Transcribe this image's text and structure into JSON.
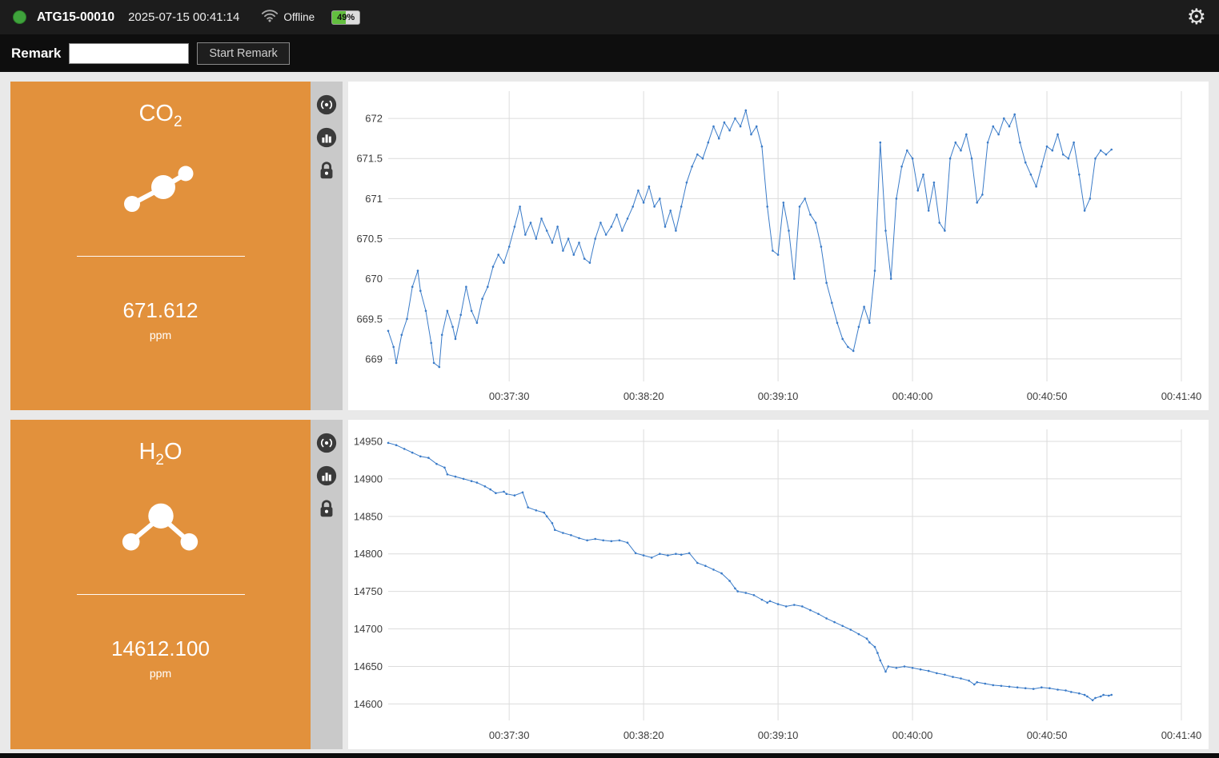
{
  "topbar": {
    "device_id": "ATG15-00010",
    "timestamp": "2025-07-15 00:41:14",
    "connection_status": "Offline",
    "battery_percent_label": "49%",
    "battery_level": 49,
    "status_dot_color": "#3fa33c",
    "accent_orange": "#e2913c",
    "chart_line_color": "#3a7bc8"
  },
  "remark": {
    "label": "Remark",
    "input_value": "",
    "button_label": "Start Remark"
  },
  "icons": {
    "gear": "⚙",
    "wifi": "wifi-arcs-offline",
    "battery": "battery-gauge",
    "status": "green-dot",
    "strip": [
      "broadcast",
      "bar-chart",
      "lock"
    ]
  },
  "panels": [
    {
      "gas": "co2",
      "formula": {
        "prefix": "CO",
        "sub": "2",
        "suffix": ""
      },
      "value": "671.612",
      "unit": "ppm"
    },
    {
      "gas": "h2o",
      "formula": {
        "prefix": "H",
        "sub": "2",
        "suffix": "O"
      },
      "value": "14612.100",
      "unit": "ppm"
    }
  ],
  "chart_data": [
    {
      "type": "line",
      "name": "co2",
      "series_name": "CO2 (ppm)",
      "color": "#3a7bc8",
      "grid": true,
      "x_domain_seconds": [
        0,
        295
      ],
      "x_ticks": [
        {
          "t": 45,
          "label": "00:37:30"
        },
        {
          "t": 95,
          "label": "00:38:20"
        },
        {
          "t": 145,
          "label": "00:39:10"
        },
        {
          "t": 195,
          "label": "00:40:00"
        },
        {
          "t": 245,
          "label": "00:40:50"
        },
        {
          "t": 295,
          "label": "00:41:40"
        }
      ],
      "ylim": [
        668.72,
        672.34
      ],
      "y_ticks": [
        {
          "v": 669,
          "label": "669"
        },
        {
          "v": 669.5,
          "label": "669.5"
        },
        {
          "v": 670,
          "label": "670"
        },
        {
          "v": 670.5,
          "label": "670.5"
        },
        {
          "v": 671,
          "label": "671"
        },
        {
          "v": 671.5,
          "label": "671.5"
        },
        {
          "v": 672,
          "label": "672"
        }
      ],
      "points": [
        [
          0,
          669.35
        ],
        [
          2,
          669.15
        ],
        [
          3,
          668.95
        ],
        [
          5,
          669.3
        ],
        [
          7,
          669.5
        ],
        [
          9,
          669.9
        ],
        [
          11,
          670.1
        ],
        [
          12,
          669.85
        ],
        [
          14,
          669.6
        ],
        [
          16,
          669.2
        ],
        [
          17,
          668.95
        ],
        [
          19,
          668.9
        ],
        [
          20,
          669.3
        ],
        [
          22,
          669.6
        ],
        [
          24,
          669.4
        ],
        [
          25,
          669.25
        ],
        [
          27,
          669.55
        ],
        [
          29,
          669.9
        ],
        [
          31,
          669.6
        ],
        [
          33,
          669.45
        ],
        [
          35,
          669.75
        ],
        [
          37,
          669.9
        ],
        [
          39,
          670.15
        ],
        [
          41,
          670.3
        ],
        [
          43,
          670.2
        ],
        [
          45,
          670.4
        ],
        [
          47,
          670.65
        ],
        [
          49,
          670.9
        ],
        [
          51,
          670.55
        ],
        [
          53,
          670.7
        ],
        [
          55,
          670.5
        ],
        [
          57,
          670.75
        ],
        [
          59,
          670.6
        ],
        [
          61,
          670.45
        ],
        [
          63,
          670.65
        ],
        [
          65,
          670.35
        ],
        [
          67,
          670.5
        ],
        [
          69,
          670.3
        ],
        [
          71,
          670.45
        ],
        [
          73,
          670.25
        ],
        [
          75,
          670.2
        ],
        [
          77,
          670.5
        ],
        [
          79,
          670.7
        ],
        [
          81,
          670.55
        ],
        [
          83,
          670.65
        ],
        [
          85,
          670.8
        ],
        [
          87,
          670.6
        ],
        [
          89,
          670.75
        ],
        [
          91,
          670.9
        ],
        [
          93,
          671.1
        ],
        [
          95,
          670.95
        ],
        [
          97,
          671.15
        ],
        [
          99,
          670.9
        ],
        [
          101,
          671.0
        ],
        [
          103,
          670.65
        ],
        [
          105,
          670.85
        ],
        [
          107,
          670.6
        ],
        [
          109,
          670.9
        ],
        [
          111,
          671.2
        ],
        [
          113,
          671.4
        ],
        [
          115,
          671.55
        ],
        [
          117,
          671.5
        ],
        [
          119,
          671.7
        ],
        [
          121,
          671.9
        ],
        [
          123,
          671.75
        ],
        [
          125,
          671.95
        ],
        [
          127,
          671.85
        ],
        [
          129,
          672.0
        ],
        [
          131,
          671.9
        ],
        [
          133,
          672.1
        ],
        [
          135,
          671.8
        ],
        [
          137,
          671.9
        ],
        [
          139,
          671.65
        ],
        [
          141,
          670.9
        ],
        [
          143,
          670.35
        ],
        [
          145,
          670.3
        ],
        [
          147,
          670.95
        ],
        [
          149,
          670.6
        ],
        [
          151,
          670.0
        ],
        [
          153,
          670.9
        ],
        [
          155,
          671.0
        ],
        [
          157,
          670.8
        ],
        [
          159,
          670.7
        ],
        [
          161,
          670.4
        ],
        [
          163,
          669.95
        ],
        [
          165,
          669.7
        ],
        [
          167,
          669.45
        ],
        [
          169,
          669.25
        ],
        [
          171,
          669.15
        ],
        [
          173,
          669.1
        ],
        [
          175,
          669.4
        ],
        [
          177,
          669.65
        ],
        [
          179,
          669.45
        ],
        [
          181,
          670.1
        ],
        [
          183,
          671.7
        ],
        [
          185,
          670.6
        ],
        [
          187,
          670.0
        ],
        [
          189,
          671.0
        ],
        [
          191,
          671.4
        ],
        [
          193,
          671.6
        ],
        [
          195,
          671.5
        ],
        [
          197,
          671.1
        ],
        [
          199,
          671.3
        ],
        [
          201,
          670.85
        ],
        [
          203,
          671.2
        ],
        [
          205,
          670.7
        ],
        [
          207,
          670.6
        ],
        [
          209,
          671.5
        ],
        [
          211,
          671.7
        ],
        [
          213,
          671.6
        ],
        [
          215,
          671.8
        ],
        [
          217,
          671.5
        ],
        [
          219,
          670.95
        ],
        [
          221,
          671.05
        ],
        [
          223,
          671.7
        ],
        [
          225,
          671.9
        ],
        [
          227,
          671.8
        ],
        [
          229,
          672.0
        ],
        [
          231,
          671.9
        ],
        [
          233,
          672.05
        ],
        [
          235,
          671.7
        ],
        [
          237,
          671.45
        ],
        [
          239,
          671.3
        ],
        [
          241,
          671.15
        ],
        [
          243,
          671.4
        ],
        [
          245,
          671.65
        ],
        [
          247,
          671.6
        ],
        [
          249,
          671.8
        ],
        [
          251,
          671.55
        ],
        [
          253,
          671.5
        ],
        [
          255,
          671.7
        ],
        [
          257,
          671.3
        ],
        [
          259,
          670.85
        ],
        [
          261,
          671.0
        ],
        [
          263,
          671.5
        ],
        [
          265,
          671.6
        ],
        [
          267,
          671.55
        ],
        [
          269,
          671.612
        ]
      ]
    },
    {
      "type": "line",
      "name": "h2o",
      "series_name": "H2O (ppm)",
      "color": "#3a7bc8",
      "grid": true,
      "x_domain_seconds": [
        0,
        295
      ],
      "x_ticks": [
        {
          "t": 45,
          "label": "00:37:30"
        },
        {
          "t": 95,
          "label": "00:38:20"
        },
        {
          "t": 145,
          "label": "00:39:10"
        },
        {
          "t": 195,
          "label": "00:40:00"
        },
        {
          "t": 245,
          "label": "00:40:50"
        },
        {
          "t": 295,
          "label": "00:41:40"
        }
      ],
      "ylim": [
        14578,
        14966
      ],
      "y_ticks": [
        {
          "v": 14600,
          "label": "14600"
        },
        {
          "v": 14650,
          "label": "14650"
        },
        {
          "v": 14700,
          "label": "14700"
        },
        {
          "v": 14750,
          "label": "14750"
        },
        {
          "v": 14800,
          "label": "14800"
        },
        {
          "v": 14850,
          "label": "14850"
        },
        {
          "v": 14900,
          "label": "14900"
        },
        {
          "v": 14950,
          "label": "14950"
        }
      ],
      "points": [
        [
          0,
          14948
        ],
        [
          3,
          14945
        ],
        [
          6,
          14940
        ],
        [
          9,
          14935
        ],
        [
          12,
          14930
        ],
        [
          15,
          14928
        ],
        [
          18,
          14920
        ],
        [
          21,
          14915
        ],
        [
          22,
          14906
        ],
        [
          25,
          14903
        ],
        [
          28,
          14900
        ],
        [
          31,
          14897
        ],
        [
          33,
          14895
        ],
        [
          36,
          14890
        ],
        [
          38,
          14886
        ],
        [
          40,
          14881
        ],
        [
          43,
          14883
        ],
        [
          44,
          14880
        ],
        [
          47,
          14878
        ],
        [
          50,
          14882
        ],
        [
          52,
          14862
        ],
        [
          55,
          14858
        ],
        [
          58,
          14855
        ],
        [
          59,
          14850
        ],
        [
          61,
          14841
        ],
        [
          62,
          14832
        ],
        [
          65,
          14828
        ],
        [
          68,
          14825
        ],
        [
          71,
          14821
        ],
        [
          74,
          14818
        ],
        [
          77,
          14820
        ],
        [
          80,
          14818
        ],
        [
          83,
          14817
        ],
        [
          86,
          14818
        ],
        [
          89,
          14815
        ],
        [
          92,
          14801
        ],
        [
          95,
          14798
        ],
        [
          98,
          14795
        ],
        [
          101,
          14800
        ],
        [
          104,
          14798
        ],
        [
          107,
          14800
        ],
        [
          109,
          14799
        ],
        [
          112,
          14801
        ],
        [
          115,
          14788
        ],
        [
          118,
          14784
        ],
        [
          121,
          14779
        ],
        [
          124,
          14774
        ],
        [
          127,
          14764
        ],
        [
          129,
          14754
        ],
        [
          130,
          14750
        ],
        [
          133,
          14748
        ],
        [
          136,
          14745
        ],
        [
          139,
          14739
        ],
        [
          141,
          14735
        ],
        [
          142,
          14737
        ],
        [
          145,
          14733
        ],
        [
          148,
          14730
        ],
        [
          151,
          14732
        ],
        [
          154,
          14730
        ],
        [
          157,
          14725
        ],
        [
          160,
          14720
        ],
        [
          163,
          14714
        ],
        [
          166,
          14709
        ],
        [
          169,
          14704
        ],
        [
          172,
          14699
        ],
        [
          175,
          14693
        ],
        [
          178,
          14687
        ],
        [
          179,
          14682
        ],
        [
          181,
          14676
        ],
        [
          182,
          14668
        ],
        [
          183,
          14658
        ],
        [
          185,
          14643
        ],
        [
          186,
          14650
        ],
        [
          189,
          14648
        ],
        [
          192,
          14650
        ],
        [
          195,
          14648
        ],
        [
          198,
          14646
        ],
        [
          201,
          14644
        ],
        [
          204,
          14641
        ],
        [
          207,
          14639
        ],
        [
          210,
          14636
        ],
        [
          213,
          14634
        ],
        [
          216,
          14631
        ],
        [
          218,
          14626
        ],
        [
          219,
          14629
        ],
        [
          222,
          14627
        ],
        [
          225,
          14625
        ],
        [
          228,
          14624
        ],
        [
          231,
          14623
        ],
        [
          234,
          14622
        ],
        [
          237,
          14621
        ],
        [
          240,
          14620
        ],
        [
          243,
          14622
        ],
        [
          246,
          14621
        ],
        [
          249,
          14619
        ],
        [
          252,
          14618
        ],
        [
          254,
          14616
        ],
        [
          257,
          14614
        ],
        [
          259,
          14612
        ],
        [
          260,
          14610
        ],
        [
          262,
          14605
        ],
        [
          263,
          14608
        ],
        [
          265,
          14610
        ],
        [
          266,
          14612
        ],
        [
          268,
          14611
        ],
        [
          269,
          14612.1
        ]
      ]
    }
  ]
}
